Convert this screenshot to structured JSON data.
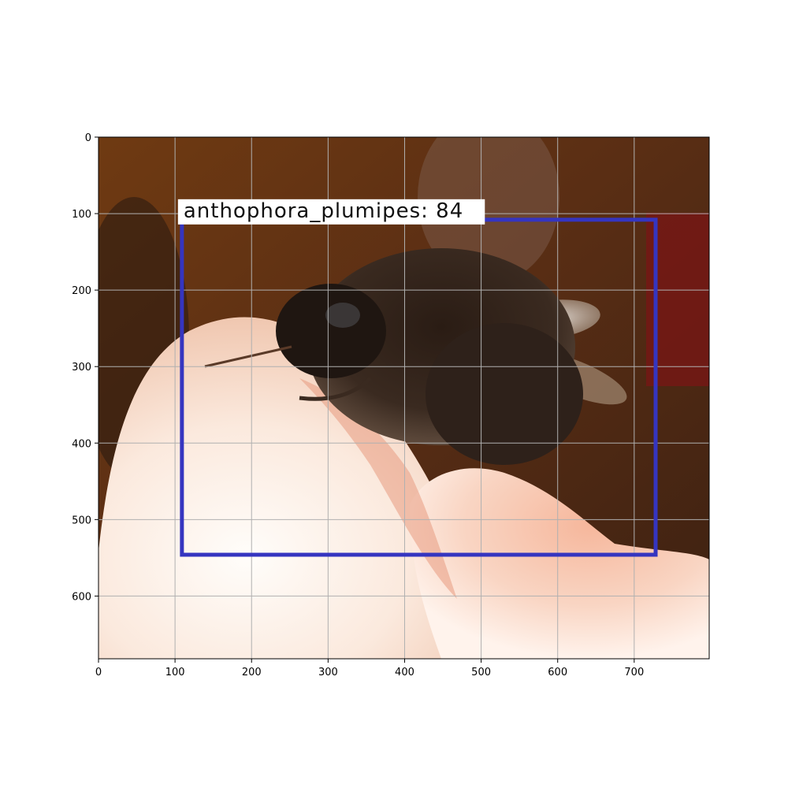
{
  "image": {
    "axes": {
      "x_range": [
        0,
        798
      ],
      "y_range": [
        0,
        682
      ],
      "grid": true,
      "grid_color": "#b0b0b0"
    },
    "x_ticks": [
      0,
      100,
      200,
      300,
      400,
      500,
      600,
      700
    ],
    "y_ticks": [
      0,
      100,
      200,
      300,
      400,
      500,
      600
    ],
    "detection": {
      "label": "anthophora_plumipes: 84",
      "box": {
        "x_min": 109,
        "y_min": 108,
        "x_max": 728,
        "y_max": 546
      },
      "box_color": "#3535c0"
    }
  }
}
